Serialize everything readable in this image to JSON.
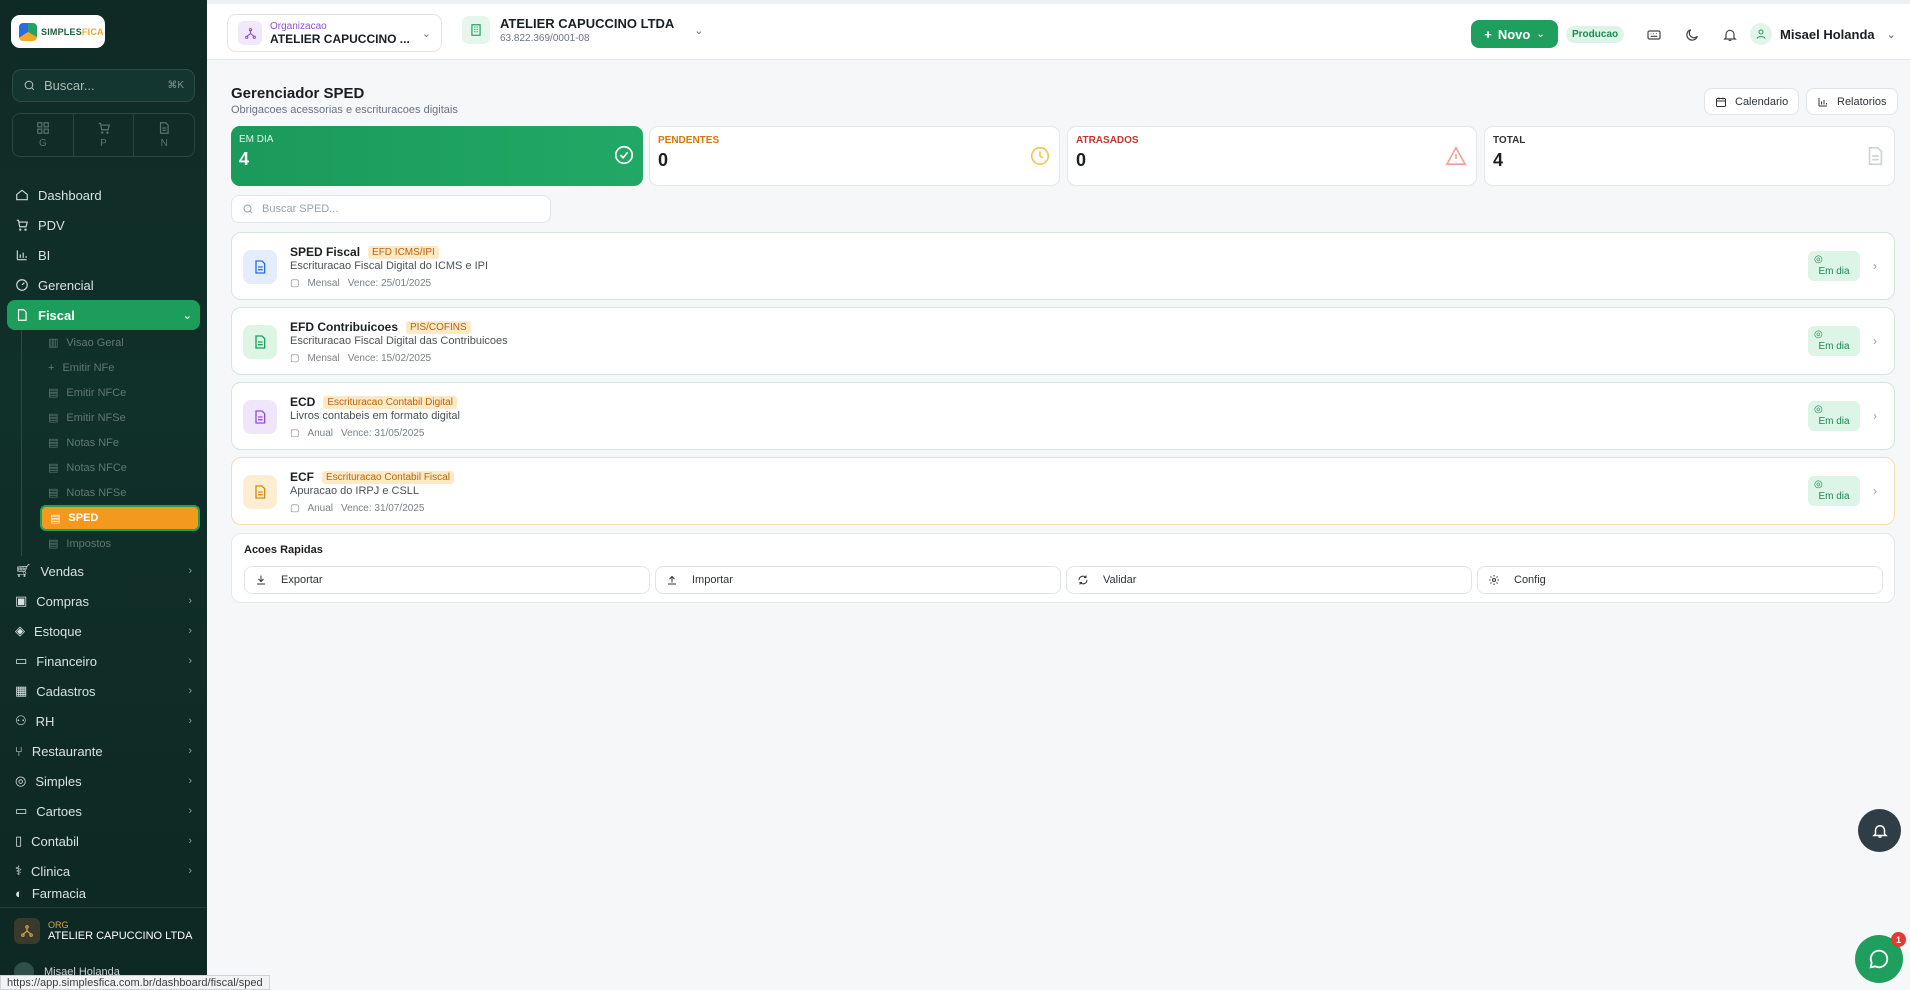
{
  "brand": {
    "logo_a": "SIMPLES",
    "logo_b": "FICA"
  },
  "sidebar": {
    "search_placeholder": "Buscar...",
    "search_kbd": "⌘K",
    "tiles": [
      {
        "label": "G"
      },
      {
        "label": "P"
      },
      {
        "label": "N"
      }
    ],
    "items": [
      {
        "label": "Dashboard",
        "icon": "home-icon"
      },
      {
        "label": "PDV",
        "icon": "cart-icon"
      },
      {
        "label": "BI",
        "icon": "chart-icon"
      },
      {
        "label": "Gerencial",
        "icon": "gauge-icon"
      },
      {
        "label": "Fiscal",
        "icon": "document-icon"
      }
    ],
    "fiscal_sub": [
      {
        "label": "Visao Geral"
      },
      {
        "label": "Emitir NFe"
      },
      {
        "label": "Emitir NFCe"
      },
      {
        "label": "Emitir NFSe"
      },
      {
        "label": "Notas NFe"
      },
      {
        "label": "Notas NFCe"
      },
      {
        "label": "Notas NFSe"
      },
      {
        "label": "SPED"
      },
      {
        "label": "Impostos"
      }
    ],
    "items_after": [
      {
        "label": "Vendas"
      },
      {
        "label": "Compras"
      },
      {
        "label": "Estoque"
      },
      {
        "label": "Financeiro"
      },
      {
        "label": "Cadastros"
      },
      {
        "label": "RH"
      },
      {
        "label": "Restaurante"
      },
      {
        "label": "Simples"
      },
      {
        "label": "Cartoes"
      },
      {
        "label": "Contabil"
      },
      {
        "label": "Clinica"
      },
      {
        "label": "Farmacia"
      }
    ],
    "org_label": "ORG",
    "org_name": "ATELIER CAPUCCINO LTDA",
    "user_name": "Misael Holanda"
  },
  "header": {
    "org_label": "Organizacao",
    "org_value": "ATELIER CAPUCCINO ...",
    "company_name": "ATELIER CAPUCCINO LTDA",
    "company_cnpj": "63.822.369/0001-08",
    "novo_label": "Novo",
    "env_badge": "Producao",
    "user_name": "Misael Holanda"
  },
  "main": {
    "title": "Gerenciador SPED",
    "subtitle": "Obrigacoes acessorias e escrituracoes digitais",
    "calendar_btn": "Calendario",
    "reports_btn": "Relatorios",
    "stats": [
      {
        "label": "EM DIA",
        "value": "4"
      },
      {
        "label": "PENDENTES",
        "value": "0"
      },
      {
        "label": "ATRASADOS",
        "value": "0"
      },
      {
        "label": "TOTAL",
        "value": "4"
      }
    ],
    "search_placeholder": "Buscar SPED...",
    "obligations": [
      {
        "title": "SPED Fiscal",
        "tag": "EFD ICMS/IPI",
        "desc": "Escrituracao Fiscal Digital do ICMS e IPI",
        "period": "Mensal",
        "due": "Vence: 25/01/2025",
        "status": "Em dia"
      },
      {
        "title": "EFD Contribuicoes",
        "tag": "PIS/COFINS",
        "desc": "Escrituracao Fiscal Digital das Contribuicoes",
        "period": "Mensal",
        "due": "Vence: 15/02/2025",
        "status": "Em dia"
      },
      {
        "title": "ECD",
        "tag": "Escrituracao Contabil Digital",
        "desc": "Livros contabeis em formato digital",
        "period": "Anual",
        "due": "Vence: 31/05/2025",
        "status": "Em dia"
      },
      {
        "title": "ECF",
        "tag": "Escrituracao Contabil Fiscal",
        "desc": "Apuracao do IRPJ e CSLL",
        "period": "Anual",
        "due": "Vence: 31/07/2025",
        "status": "Em dia"
      }
    ],
    "quick_title": "Acoes Rapidas",
    "quick_actions": [
      {
        "label": "Exportar"
      },
      {
        "label": "Importar"
      },
      {
        "label": "Validar"
      },
      {
        "label": "Config"
      }
    ]
  },
  "fab": {
    "chat_count": "1"
  },
  "status_url": "https://app.simplesfica.com.br/dashboard/fiscal/sped",
  "colors": {
    "accent": "#1f9f5e",
    "active_sub": "#f39a1e",
    "sidebar_bg": "#0f2a24"
  }
}
